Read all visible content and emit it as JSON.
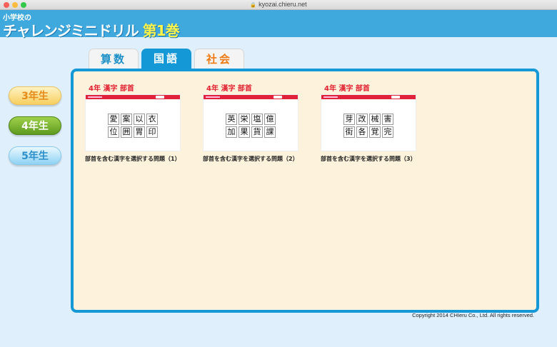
{
  "window": {
    "url": "kyozai.chieru.net"
  },
  "header": {
    "logo_top": "小学校の",
    "logo_main": "チャレンジミニドリル",
    "logo_volume": "第1巻"
  },
  "tabs": [
    {
      "label": "算数",
      "selected": false
    },
    {
      "label": "国語",
      "selected": true
    },
    {
      "label": "社会",
      "selected": false
    }
  ],
  "grades": [
    {
      "label": "3年生",
      "selected": false
    },
    {
      "label": "4年生",
      "selected": true
    },
    {
      "label": "5年生",
      "selected": false
    }
  ],
  "cards": [
    {
      "title": "4年 漢字 部首",
      "kanji": [
        "愛",
        "案",
        "以",
        "衣",
        "位",
        "囲",
        "胃",
        "印"
      ],
      "caption": "部首を含む漢字を選択する問題（1）"
    },
    {
      "title": "4年 漢字 部首",
      "kanji": [
        "英",
        "栄",
        "塩",
        "億",
        "加",
        "果",
        "貨",
        "課"
      ],
      "caption": "部首を含む漢字を選択する問題（2）"
    },
    {
      "title": "4年 漢字 部首",
      "kanji": [
        "芽",
        "改",
        "械",
        "害",
        "街",
        "各",
        "覚",
        "完"
      ],
      "caption": "部首を含む漢字を選択する問題（3）"
    }
  ],
  "footer": {
    "copyright": "Copyright 2014 CHIeru Co., Ltd. All rights reserved."
  },
  "colors": {
    "header": "#3fa9dd",
    "accent": "#1598d6",
    "panel_bg": "#fdf3dc",
    "card_title": "#e1202f",
    "math_tab": "#1e90c8",
    "social_tab": "#ef7a12",
    "grade_selected": "#6aa826"
  }
}
